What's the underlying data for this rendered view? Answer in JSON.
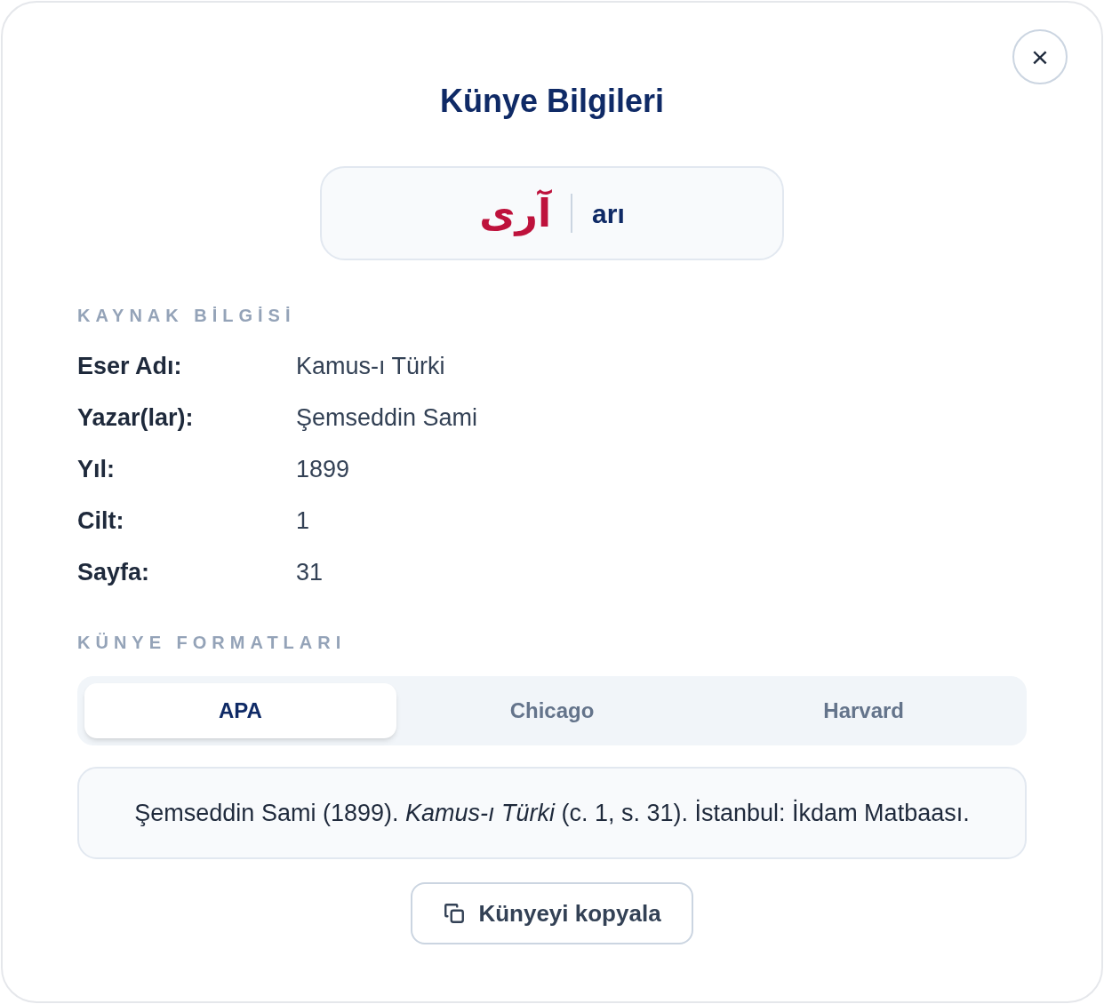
{
  "dialog": {
    "title": "Künye Bilgileri",
    "close": "×"
  },
  "word": {
    "arabic": "آرى",
    "latin": "arı"
  },
  "source_section": {
    "heading": "KAYNAK BİLGİSİ",
    "fields": [
      {
        "label": "Eser Adı:",
        "value": "Kamus-ı Türki"
      },
      {
        "label": "Yazar(lar):",
        "value": "Şemseddin Sami"
      },
      {
        "label": "Yıl:",
        "value": "1899"
      },
      {
        "label": "Cilt:",
        "value": "1"
      },
      {
        "label": "Sayfa:",
        "value": "31"
      }
    ]
  },
  "formats_section": {
    "heading": "KÜNYE FORMATLARI",
    "tabs": [
      {
        "label": "APA",
        "selected": true
      },
      {
        "label": "Chicago",
        "selected": false
      },
      {
        "label": "Harvard",
        "selected": false
      }
    ],
    "citation": "Şemseddin Sami (1899). *Kamus-ı Türki* (c. 1, s. 31). İstanbul: İkdam Matbaası.",
    "copy_button": "Künyeyi kopyala"
  }
}
